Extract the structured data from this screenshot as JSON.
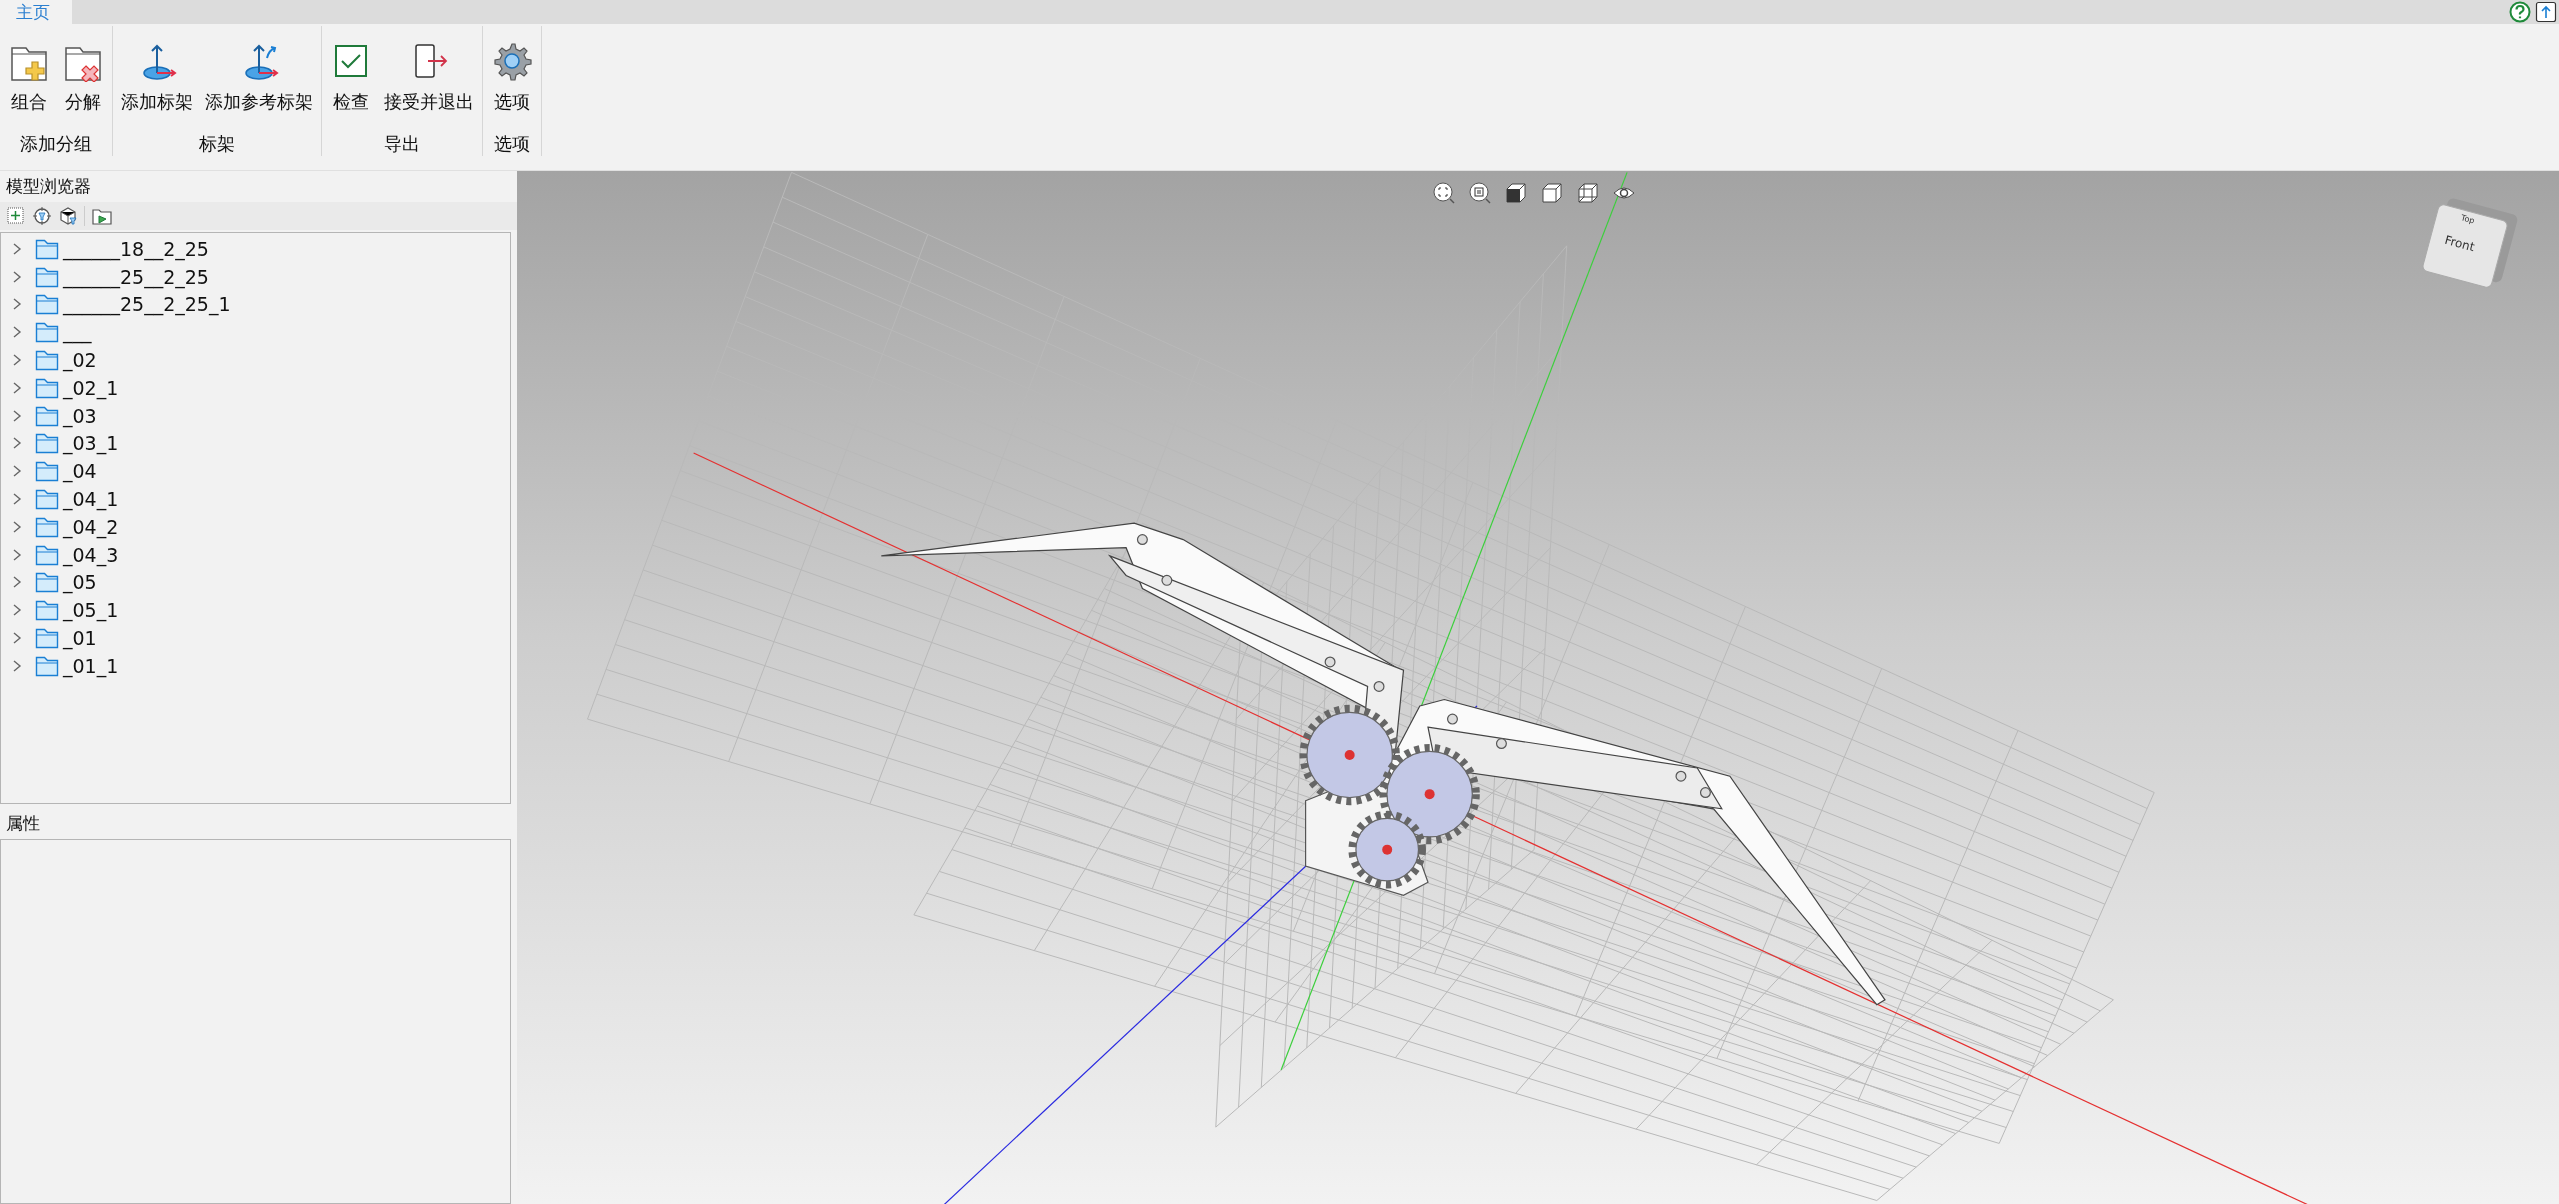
{
  "tabs": [
    {
      "label": "主页",
      "selected": true
    }
  ],
  "ribbon": {
    "groups": [
      {
        "label": "添加分组",
        "buttons": [
          {
            "label": "组合",
            "kind": "group"
          },
          {
            "label": "分解",
            "kind": "ungroup"
          }
        ]
      },
      {
        "label": "标架",
        "buttons": [
          {
            "label": "添加标架",
            "kind": "frame"
          },
          {
            "label": "添加参考标架",
            "kind": "ref_frame"
          }
        ]
      },
      {
        "label": "导出",
        "buttons": [
          {
            "label": "检查",
            "kind": "check"
          },
          {
            "label": "接受并退出",
            "kind": "exit"
          }
        ]
      },
      {
        "label": "选项",
        "buttons": [
          {
            "label": "选项",
            "kind": "gear"
          }
        ]
      }
    ]
  },
  "model_browser": {
    "title": "模型浏览器",
    "items": [
      {
        "label": "______18__2_25",
        "expanded": false
      },
      {
        "label": "______25__2_25",
        "expanded": false
      },
      {
        "label": "______25__2_25_1",
        "expanded": false
      },
      {
        "label": "___",
        "expanded": false
      },
      {
        "label": "_02",
        "expanded": false
      },
      {
        "label": "_02_1",
        "expanded": false
      },
      {
        "label": "_03",
        "expanded": false
      },
      {
        "label": "_03_1",
        "expanded": false
      },
      {
        "label": "_04",
        "expanded": false
      },
      {
        "label": "_04_1",
        "expanded": false
      },
      {
        "label": "_04_2",
        "expanded": false
      },
      {
        "label": "_04_3",
        "expanded": false
      },
      {
        "label": "_05",
        "expanded": false
      },
      {
        "label": "_05_1",
        "expanded": false
      },
      {
        "label": "_01",
        "expanded": false
      },
      {
        "label": "_01_1",
        "expanded": false
      }
    ]
  },
  "properties": {
    "title": "属性"
  },
  "view_cube": {
    "front": "Front",
    "top": "Top"
  }
}
